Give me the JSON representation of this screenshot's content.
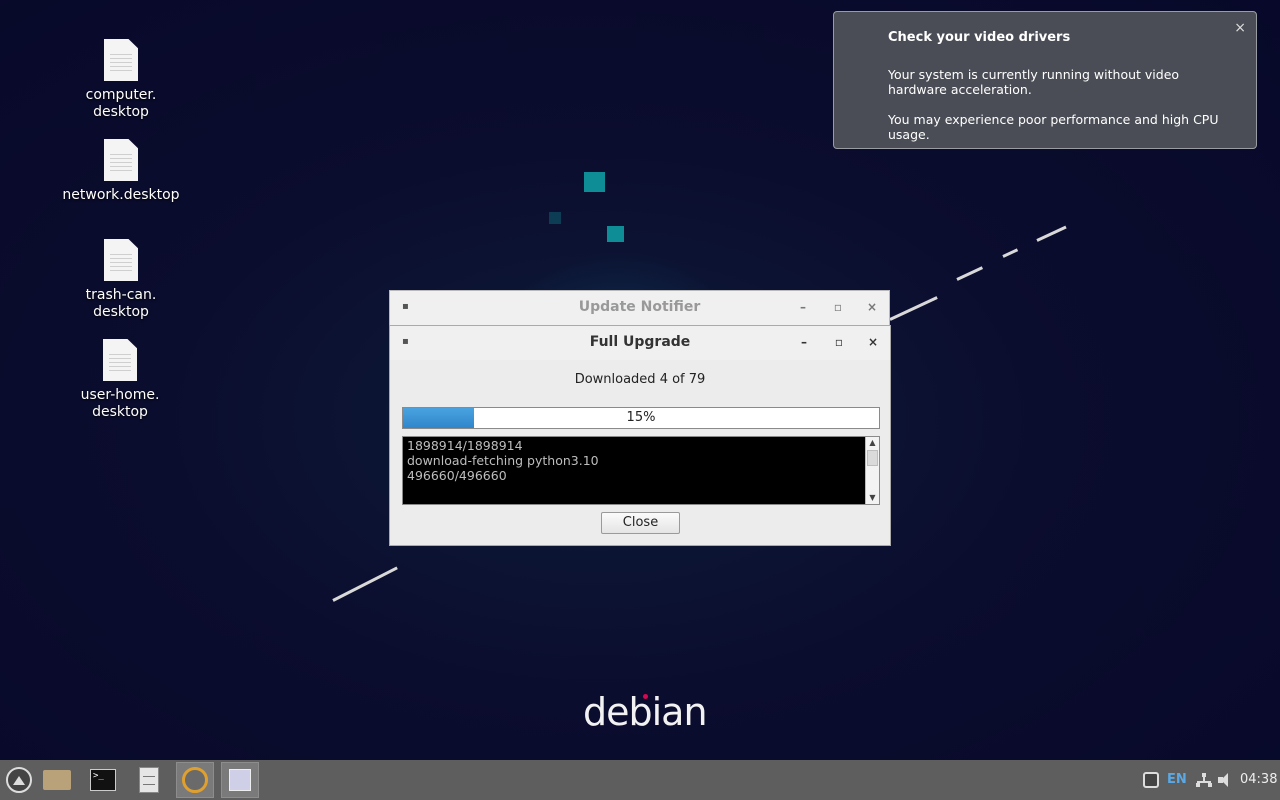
{
  "desktop": {
    "icons": [
      {
        "label": "computer.\ndesktop"
      },
      {
        "label": "network.desktop"
      },
      {
        "label": "trash-can.\ndesktop"
      },
      {
        "label": "user-home.\ndesktop"
      }
    ],
    "wallpaper_text": "debian"
  },
  "notification": {
    "title": "Check your video drivers",
    "paragraph1": "Your system is currently running without video hardware acceleration.",
    "paragraph2": "You may experience poor performance and high CPU usage.",
    "close_glyph": "×"
  },
  "update_notifier": {
    "title": "Update Notifier",
    "minimize_glyph": "–",
    "maximize_glyph": "▫",
    "close_glyph": "×"
  },
  "full_upgrade": {
    "title": "Full Upgrade",
    "minimize_glyph": "–",
    "maximize_glyph": "▫",
    "close_glyph": "×",
    "status": "Downloaded 4 of 79",
    "progress_percent": 15,
    "progress_label": "15%",
    "log_lines": [
      "1898914/1898914",
      "download-fetching python3.10",
      "496660/496660"
    ],
    "close_button": "Close"
  },
  "taskbar": {
    "items": [
      {
        "name": "app-menu",
        "icon": "menu-icon"
      },
      {
        "name": "file-manager",
        "icon": "folder-icon"
      },
      {
        "name": "terminal",
        "icon": "terminal-icon",
        "text": ">_"
      },
      {
        "name": "file-cabinet",
        "icon": "cabinet-icon"
      },
      {
        "name": "update-notifier",
        "icon": "updater-icon"
      },
      {
        "name": "full-upgrade",
        "icon": "diamond-icon"
      }
    ],
    "tray": {
      "language": "EN",
      "clock": "04:38"
    }
  },
  "colors": {
    "desktop_bg": "#0a0b2a",
    "taskbar_bg": "#5e5e5e",
    "progress_fill": "#2f86cc",
    "accent_lang": "#5aa9e6"
  }
}
